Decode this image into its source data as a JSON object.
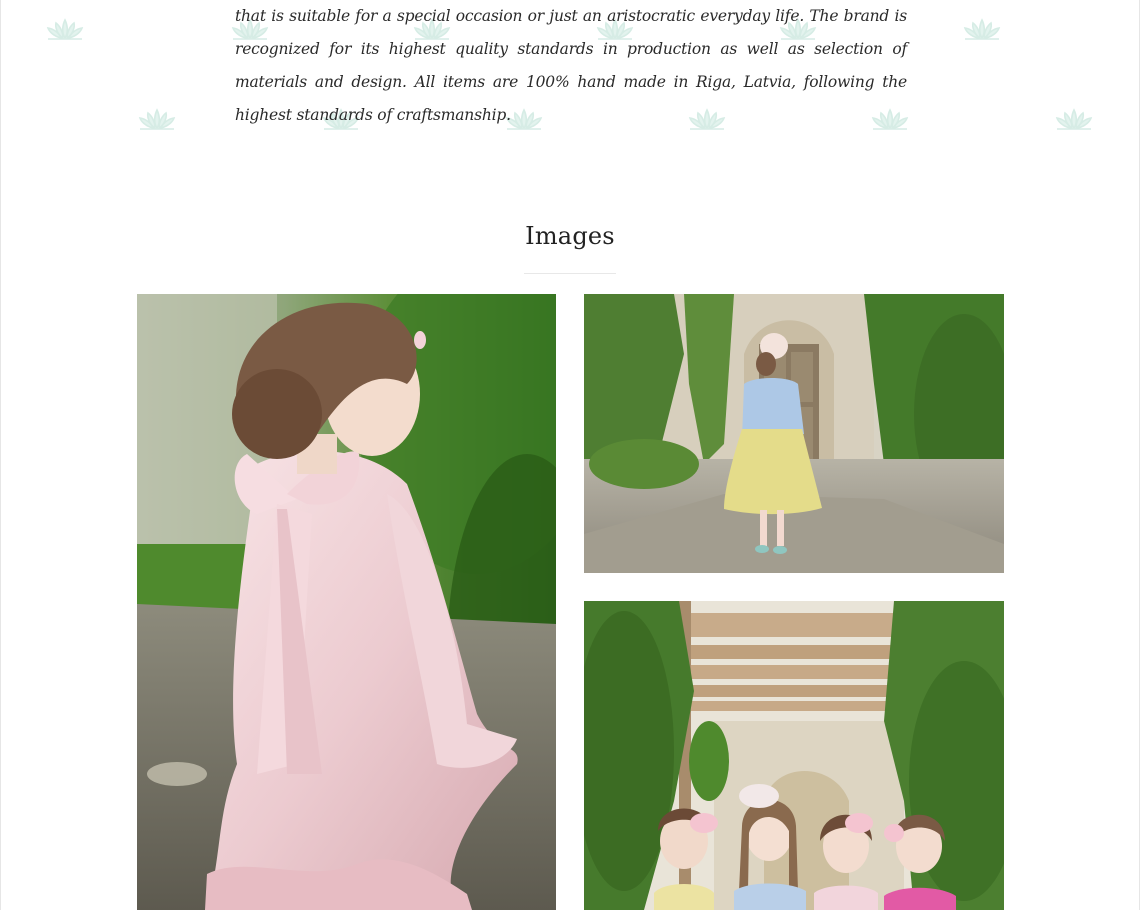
{
  "intro": {
    "text": "that is suitable for a special occasion or just an aristocratic everyday life. The brand is recognized for its highest quality standards in production as well as selection of materials and design. All items are 100% hand made in Riga, Latvia, following the highest standards of craftsmanship."
  },
  "gallery": {
    "title": "Images",
    "images": [
      {
        "name": "girl-in-pink-dress-with-bow-photo"
      },
      {
        "name": "girl-in-blue-jacket-yellow-skirt-photo"
      },
      {
        "name": "four-girls-under-pergola-photo"
      }
    ]
  },
  "colors": {
    "pattern": "#d9eee7",
    "text": "#2a2a2a",
    "rule": "#e8e8e8"
  },
  "icons": [
    "lotus-pattern-icon"
  ]
}
